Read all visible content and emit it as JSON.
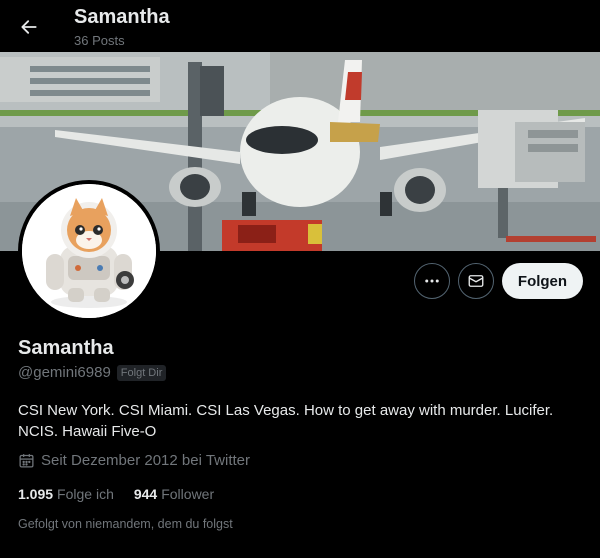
{
  "header": {
    "name": "Samantha",
    "post_count": "36 Posts"
  },
  "profile": {
    "name": "Samantha",
    "handle": "@gemini6989",
    "follows_you_badge": "Folgt Dir",
    "bio": "CSI New York. CSI Miami. CSI Las Vegas. How to get away with murder. Lucifer. NCIS. Hawaii Five-O",
    "joined": "Seit Dezember 2012 bei Twitter",
    "following_count": "1.095",
    "following_label": "Folge ich",
    "followers_count": "944",
    "followers_label": "Follower",
    "followed_by": "Gefolgt von niemandem, dem du folgst"
  },
  "actions": {
    "follow_label": "Folgen"
  },
  "icons": {
    "back": "arrow-left-icon",
    "more": "more-dots-icon",
    "message": "envelope-icon",
    "calendar": "calendar-icon"
  },
  "colors": {
    "background": "#000000",
    "text_primary": "#e7e9ea",
    "text_secondary": "#71767b",
    "follow_button_bg": "#eff3f4",
    "border": "#536471"
  }
}
